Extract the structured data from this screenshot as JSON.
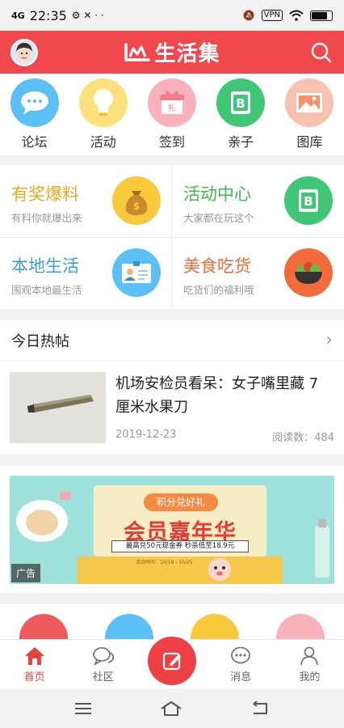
{
  "status_bar": {
    "signal": "4G",
    "time": "22:35",
    "extra": "⚙ ✕ · ·",
    "vpn": "VPN"
  },
  "header": {
    "title": "生活集",
    "avatar": "avatar",
    "search_icon": "search-icon"
  },
  "quick_nav": [
    {
      "label": "论坛",
      "icon": "chat-bubble-icon",
      "color": "#45b5f0"
    },
    {
      "label": "活动",
      "icon": "lightbulb-icon",
      "color": "#f7c934"
    },
    {
      "label": "签到",
      "icon": "gift-icon",
      "color": "#f57d8f"
    },
    {
      "label": "亲子",
      "icon": "book-icon",
      "color": "#35c46b"
    },
    {
      "label": "图库",
      "icon": "picture-icon",
      "color": "#f08a5a"
    }
  ],
  "feature_grid": [
    {
      "title": "有奖爆料",
      "subtitle": "有料你就爆出来",
      "title_color": "#e8a91f",
      "icon": "money-bag-icon"
    },
    {
      "title": "活动中心",
      "subtitle": "大家都在玩这个",
      "title_color": "#42b84f",
      "icon": "book-icon"
    },
    {
      "title": "本地生活",
      "subtitle": "围观本地最生活",
      "title_color": "#3c9fd6",
      "icon": "id-card-icon"
    },
    {
      "title": "美食吃货",
      "subtitle": "吃货们的福利哦",
      "title_color": "#f06a3c",
      "icon": "salad-bowl-icon"
    }
  ],
  "hot_posts": {
    "header": "今日热帖",
    "more_icon": "chevron-right-icon",
    "post": {
      "title": "机场安检员看呆：女子嘴里藏 7 厘米水果刀",
      "date": "2019-12-23",
      "reads": "阅读数：484"
    }
  },
  "ad_banner": {
    "pill": "积分兑好礼",
    "headline": "会员嘉年华",
    "sub": "最高兑50元现金券  秒杀低至18.9元",
    "small": "活动时间：10/18 - 10/25",
    "tag": "广告"
  },
  "tab_bar": [
    {
      "label": "首页",
      "icon": "home-icon",
      "active": true
    },
    {
      "label": "社区",
      "icon": "chat-bubbles-icon",
      "active": false
    },
    {
      "label": "",
      "icon": "edit-icon",
      "active": false
    },
    {
      "label": "消息",
      "icon": "message-icon",
      "active": false
    },
    {
      "label": "我的",
      "icon": "person-icon",
      "active": false
    }
  ],
  "colors": {
    "brand_red": "#f0484c",
    "tab_active": "#e8423f"
  }
}
